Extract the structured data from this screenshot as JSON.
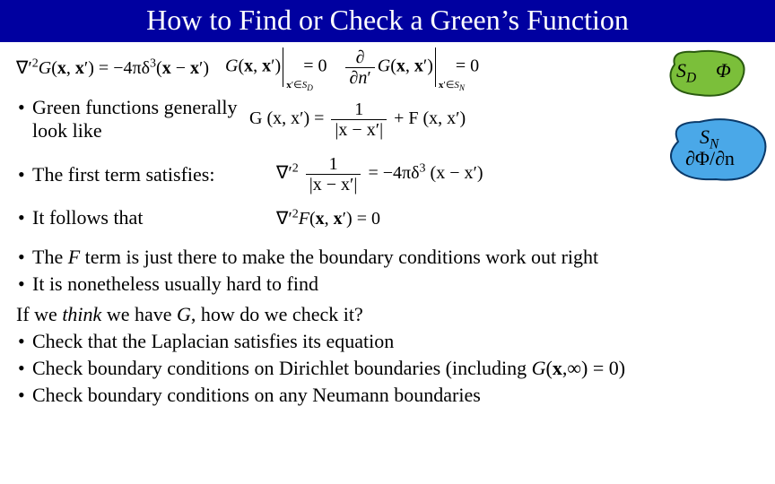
{
  "title": "How to Find or Check a Green’s Function",
  "eq1": {
    "lhs_html": "∇′{SUP2} G (x, x′) = −4πδ{SUP3} (x − x′)",
    "mid_html": "G (x, x′)|{SUB x′∈S_D} = 0",
    "rhs_html": "∂/∂n′ G (x, x′)|{SUB x′∈S_N} = 0"
  },
  "blobs": {
    "sd_label": "S",
    "sd_sub": "D",
    "phi_label": "Φ",
    "sn_label": "S",
    "sn_sub": "N",
    "dphi_label": "∂Φ/∂n"
  },
  "b1": "Green functions generally look like",
  "eq2_lhs": "G (x, x′) =",
  "eq2_frac_num": "1",
  "eq2_frac_den": "|x − x′|",
  "eq2_plus": " + F (x, x′)",
  "b2": "The first term satisfies:",
  "eq3_lhs": "∇′",
  "eq3_sup": "2",
  "eq3_frac_num": "1",
  "eq3_frac_den": "|x − x′|",
  "eq3_rhs": " = −4πδ",
  "eq3_rsup": "3",
  "eq3_end": " (x − x′)",
  "b3": "It follows that",
  "eq4": "∇′{SUP2} F (x, x′) = 0",
  "b4": "The F term is just there to make the boundary conditions work out right",
  "b5": "It is nonetheless usually hard to find",
  "plain1": "If we think we have G, how do we check it?",
  "b6": "Check that the Laplacian satisfies its equation",
  "b7": "Check boundary conditions on Dirichlet boundaries (including G(x,∞) = 0)",
  "b8": "Check boundary conditions on any Neumann boundaries"
}
